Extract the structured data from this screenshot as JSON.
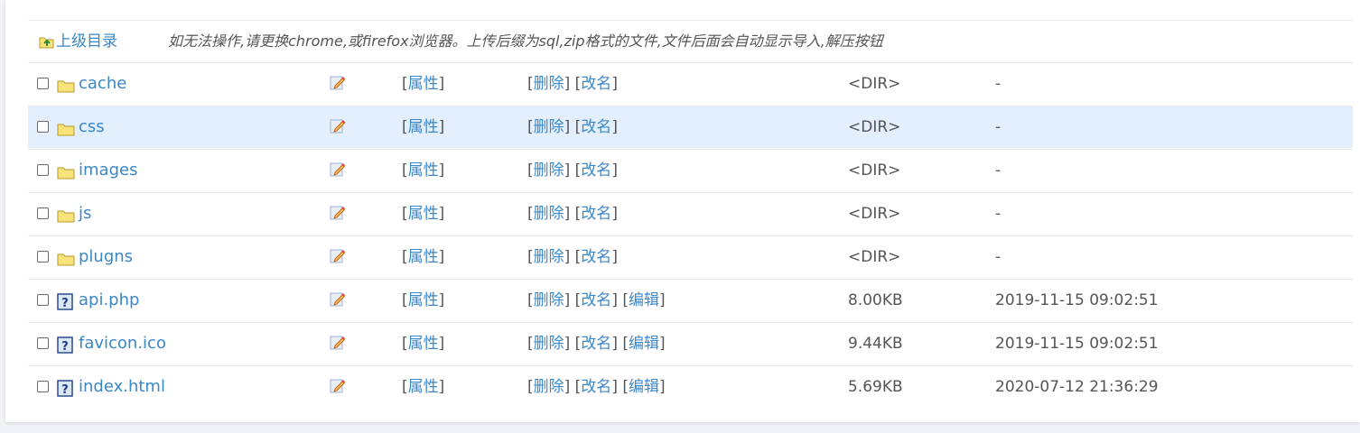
{
  "header": {
    "parent_label": "上级目录",
    "notice": "如无法操作,请更换chrome,或firefox浏览器。上传后缀为sql,zip格式的文件,文件后面会自动显示导入,解压按钮"
  },
  "labels": {
    "properties": "属性",
    "delete": "删除",
    "rename": "改名",
    "edit": "编辑"
  },
  "files": [
    {
      "name": "cache",
      "type": "folder",
      "size": "<DIR>",
      "time": "-",
      "editable": false
    },
    {
      "name": "css",
      "type": "folder",
      "size": "<DIR>",
      "time": "-",
      "editable": false,
      "highlighted": true
    },
    {
      "name": "images",
      "type": "folder",
      "size": "<DIR>",
      "time": "-",
      "editable": false
    },
    {
      "name": "js",
      "type": "folder",
      "size": "<DIR>",
      "time": "-",
      "editable": false
    },
    {
      "name": "plugns",
      "type": "folder",
      "size": "<DIR>",
      "time": "-",
      "editable": false
    },
    {
      "name": "api.php",
      "type": "file",
      "size": "8.00KB",
      "time": "2019-11-15 09:02:51",
      "editable": true
    },
    {
      "name": "favicon.ico",
      "type": "file",
      "size": "9.44KB",
      "time": "2019-11-15 09:02:51",
      "editable": true
    },
    {
      "name": "index.html",
      "type": "file",
      "size": "5.69KB",
      "time": "2020-07-12 21:36:29",
      "editable": true
    }
  ],
  "colors": {
    "link": "#3a87c9",
    "highlight_row": "#e3effc",
    "folder": "#f7e37a"
  }
}
